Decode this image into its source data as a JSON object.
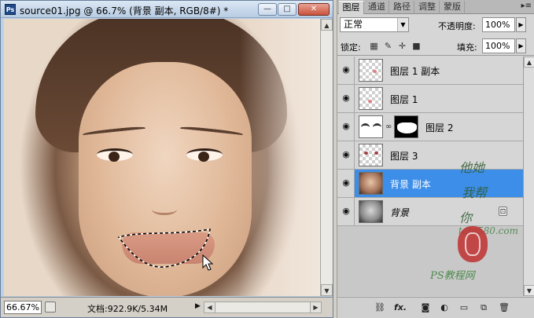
{
  "document": {
    "title": "source01.jpg @ 66.7% (背景 副本, RGB/8#) *",
    "app_icon": "Ps",
    "zoom": "66.67%",
    "doc_info": "文档:922.9K/5.34M",
    "window_buttons": {
      "minimize": "—",
      "maximize": "□",
      "close": "✕"
    }
  },
  "panel": {
    "tabs": [
      {
        "label": "图层",
        "active": true
      },
      {
        "label": "通道",
        "active": false
      },
      {
        "label": "路径",
        "active": false
      },
      {
        "label": "调整",
        "active": false
      },
      {
        "label": "蒙版",
        "active": false
      }
    ],
    "menu_icon": "▸≡",
    "blend_mode": "正常",
    "opacity_label": "不透明度:",
    "opacity_value": "100%",
    "lock_label": "锁定:",
    "fill_label": "填充:",
    "fill_value": "100%",
    "layers": [
      {
        "name": "图层 1 副本",
        "visible": true,
        "selected": false,
        "thumb": "transparent-dot"
      },
      {
        "name": "图层 1",
        "visible": true,
        "selected": false,
        "thumb": "transparent-dot"
      },
      {
        "name": "图层 2",
        "visible": true,
        "selected": false,
        "thumb": "brows",
        "has_mask": true
      },
      {
        "name": "图层 3",
        "visible": true,
        "selected": false,
        "thumb": "transparent-dots"
      },
      {
        "name": "背景 副本",
        "visible": true,
        "selected": true,
        "thumb": "face"
      },
      {
        "name": "背景",
        "visible": true,
        "selected": false,
        "thumb": "face-gray",
        "locked": true
      }
    ],
    "bottom_icons": [
      "link-icon",
      "fx-icon",
      "mask-icon",
      "adjustment-icon",
      "group-icon",
      "new-layer-icon",
      "trash-icon"
    ],
    "bottom_fx_label": "fx."
  },
  "watermark": {
    "site": "tata580.com",
    "name": "PS教程网",
    "brush_lines": [
      "他她",
      "我帮",
      "你"
    ]
  },
  "colors": {
    "selected_layer": "#3d8ee8",
    "panel_bg": "#d6d6d6",
    "title_gradient_top": "#dbe7f4"
  }
}
